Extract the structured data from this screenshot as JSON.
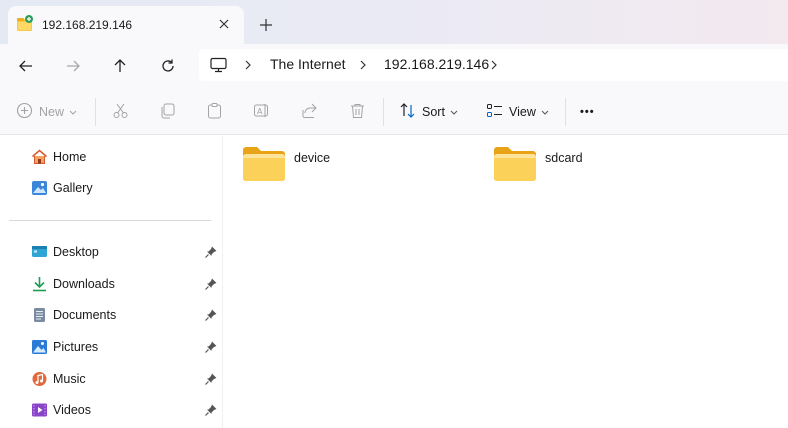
{
  "tab": {
    "title": "192.168.219.146",
    "icon": "network-folder-icon",
    "close_icon": "close-icon",
    "new_tab_icon": "plus-icon"
  },
  "nav": {
    "back_icon": "arrow-left-icon",
    "forward_icon": "arrow-right-icon",
    "up_icon": "arrow-up-icon",
    "refresh_icon": "refresh-icon"
  },
  "address": {
    "root_icon": "monitor-icon",
    "crumbs": [
      "The Internet",
      "192.168.219.146"
    ]
  },
  "commands": {
    "new_label": "New",
    "sort_label": "Sort",
    "view_label": "View",
    "more_label": "•••"
  },
  "sidebar": {
    "top_items": [
      {
        "label": "Home",
        "icon": "home-icon"
      },
      {
        "label": "Gallery",
        "icon": "gallery-icon"
      }
    ],
    "pinned_items": [
      {
        "label": "Desktop",
        "icon": "desktop-icon"
      },
      {
        "label": "Downloads",
        "icon": "download-icon"
      },
      {
        "label": "Documents",
        "icon": "document-icon"
      },
      {
        "label": "Pictures",
        "icon": "pictures-icon"
      },
      {
        "label": "Music",
        "icon": "music-icon"
      },
      {
        "label": "Videos",
        "icon": "video-icon"
      }
    ]
  },
  "folders": [
    {
      "name": "device"
    },
    {
      "name": "sdcard"
    }
  ],
  "colors": {
    "folder": "#f8c733",
    "folder_dark": "#e8a317",
    "accent": "#0067c0",
    "disabled": "#a3a3a3"
  }
}
